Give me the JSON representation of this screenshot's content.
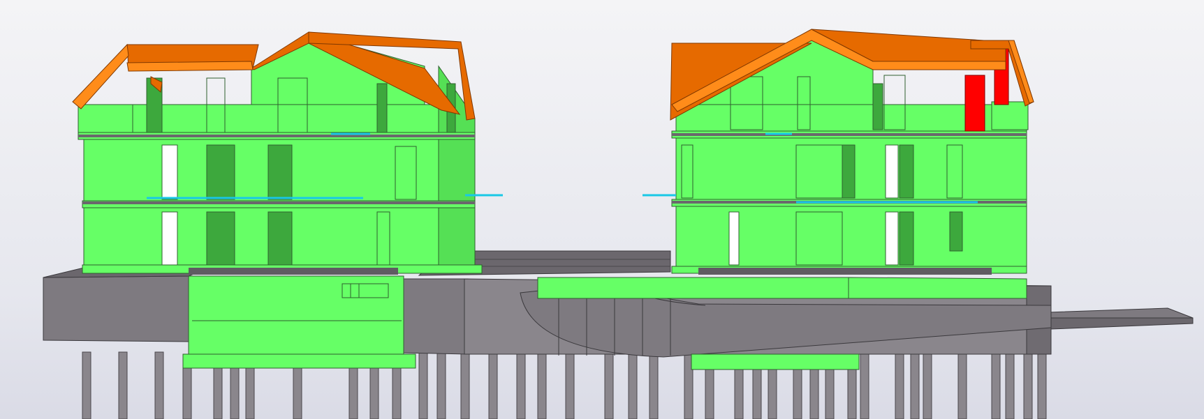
{
  "scene": {
    "description_visible_text": "",
    "colors": {
      "background_top": "#f4f4f6",
      "background_bottom": "#dadbe6",
      "wall_green": "#66ff66",
      "wall_green_dark": "#3da83d",
      "roof_orange": "#e66a00",
      "roof_orange_edge": "#ff8c1a",
      "selected_red": "#ff0000",
      "concrete_gray": "#7e7a80",
      "concrete_gray_dark": "#5f5c62",
      "rebar_cyan": "#19c8e6",
      "pile_gray": "#8a868c"
    },
    "objects": [
      {
        "name": "left-building",
        "color": "wall_green"
      },
      {
        "name": "right-building",
        "color": "wall_green"
      },
      {
        "name": "left-roof",
        "color": "roof_orange"
      },
      {
        "name": "right-roof",
        "color": "roof_orange"
      },
      {
        "name": "selected-element",
        "color": "selected_red"
      },
      {
        "name": "foundation-slab",
        "color": "concrete_gray"
      },
      {
        "name": "ramp",
        "color": "concrete_gray"
      },
      {
        "name": "piles",
        "color": "pile_gray"
      }
    ]
  }
}
